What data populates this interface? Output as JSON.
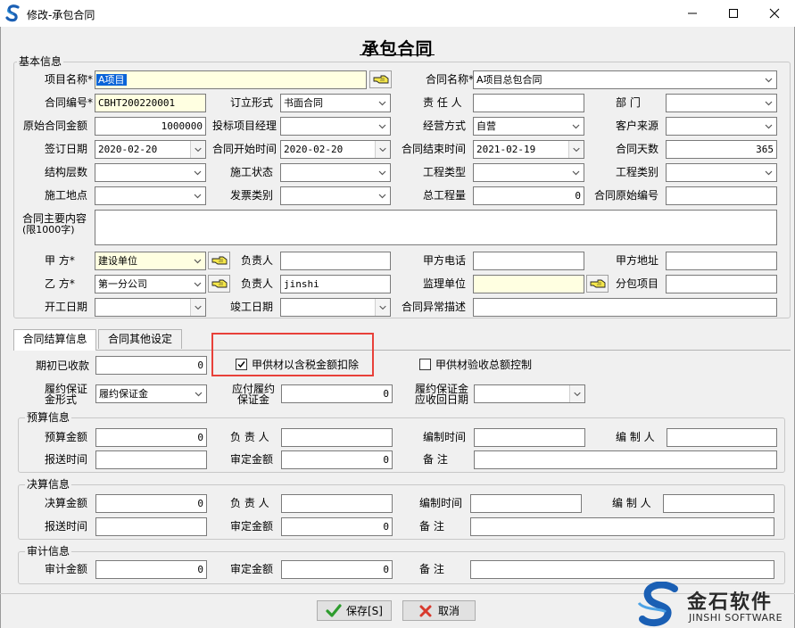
{
  "window": {
    "title": "修改-承包合同",
    "minimize": "—",
    "maximize": "□",
    "close": "✕"
  },
  "form": {
    "heading": "承包合同"
  },
  "basic": {
    "group": "基本信息",
    "project_name": {
      "label": "项目名称*",
      "value": "A项目"
    },
    "contract_name": {
      "label": "合同名称*",
      "value": "A项目总包合同"
    },
    "contract_no": {
      "label": "合同编号*",
      "value": "CBHT200220001"
    },
    "sign_form": {
      "label": "订立形式",
      "value": "书面合同"
    },
    "person_in_charge": {
      "label": "责 任 人",
      "value": ""
    },
    "department": {
      "label": "部    门",
      "value": ""
    },
    "original_amount": {
      "label": "原始合同金额",
      "value": "1000000"
    },
    "bid_manager": {
      "label": "投标项目经理",
      "value": ""
    },
    "business_mode": {
      "label": "经营方式",
      "value": "自营"
    },
    "customer_source": {
      "label": "客户来源",
      "value": ""
    },
    "sign_date": {
      "label": "签订日期",
      "value": "2020-02-20"
    },
    "start_time": {
      "label": "合同开始时间",
      "value": "2020-02-20"
    },
    "end_time": {
      "label": "合同结束时间",
      "value": "2021-02-19"
    },
    "days": {
      "label": "合同天数",
      "value": "365"
    },
    "structure_floors": {
      "label": "结构层数",
      "value": ""
    },
    "construction_state": {
      "label": "施工状态",
      "value": ""
    },
    "project_type": {
      "label": "工程类型",
      "value": ""
    },
    "project_category": {
      "label": "工程类别",
      "value": ""
    },
    "site": {
      "label": "施工地点",
      "value": ""
    },
    "invoice_type": {
      "label": "发票类别",
      "value": ""
    },
    "total_quantity": {
      "label": "总工程量",
      "value": "0"
    },
    "original_no": {
      "label": "合同原始编号",
      "value": ""
    },
    "content": {
      "label1": "合同主要内容",
      "label2": "(限1000字)",
      "value": ""
    },
    "party_a": {
      "label": "甲    方*",
      "value": "建设单位"
    },
    "a_contact": {
      "label": "负责人",
      "value": ""
    },
    "a_phone": {
      "label": "甲方电话",
      "value": ""
    },
    "a_address": {
      "label": "甲方地址",
      "value": ""
    },
    "party_b": {
      "label": "乙    方*",
      "value": "第一分公司"
    },
    "b_contact": {
      "label": "负责人",
      "value": "jinshi"
    },
    "supervisor": {
      "label": "监理单位",
      "value": ""
    },
    "subcontract": {
      "label": "分包项目",
      "value": ""
    },
    "work_start": {
      "label": "开工日期",
      "value": ""
    },
    "work_end": {
      "label": "竣工日期",
      "value": ""
    },
    "exception": {
      "label": "合同异常描述",
      "value": ""
    }
  },
  "tabs": [
    {
      "label": "合同结算信息"
    },
    {
      "label": "合同其他设定"
    }
  ],
  "settle": {
    "initial_received": {
      "label": "期初已收款",
      "value": "0"
    },
    "chk_deduct": {
      "label": "甲供材以含税金额扣除",
      "checked": true
    },
    "chk_total": {
      "label": "甲供材验收总额控制",
      "checked": false
    },
    "bond_form": {
      "label1": "履约保证",
      "label2": "金形式",
      "value": "履约保证金"
    },
    "bond_payable": {
      "label1": "应付履约",
      "label2": "保证金",
      "value": "0"
    },
    "bond_date": {
      "label1": "履约保证金",
      "label2": "应收回日期",
      "value": ""
    }
  },
  "budget": {
    "group": "预算信息",
    "amount": {
      "label": "预算金额",
      "value": "0"
    },
    "contact": {
      "label": "负 责 人",
      "value": ""
    },
    "made_time": {
      "label": "编制时间",
      "value": ""
    },
    "maker": {
      "label": "编 制 人",
      "value": ""
    },
    "send_time": {
      "label": "报送时间",
      "value": ""
    },
    "approved": {
      "label": "审定金额",
      "value": "0"
    },
    "note": {
      "label": "备    注",
      "value": ""
    }
  },
  "final": {
    "group": "决算信息",
    "amount": {
      "label": "决算金额",
      "value": "0"
    },
    "contact": {
      "label": "负 责 人",
      "value": ""
    },
    "made_time": {
      "label": "编制时间",
      "value": ""
    },
    "maker": {
      "label": "编 制 人",
      "value": ""
    },
    "send_time": {
      "label": "报送时间",
      "value": ""
    },
    "approved": {
      "label": "审定金额",
      "value": "0"
    },
    "note": {
      "label": "备    注",
      "value": ""
    }
  },
  "audit": {
    "group": "审计信息",
    "amount": {
      "label": "审计金额",
      "value": "0"
    },
    "approved": {
      "label": "审定金额",
      "value": "0"
    },
    "note": {
      "label": "备    注",
      "value": ""
    }
  },
  "buttons": {
    "save": "保存[S]",
    "cancel": "取消"
  },
  "brand": {
    "name": "金石软件",
    "sub": "JINSHI SOFTWARE"
  },
  "colors": {
    "highlight": "#e8413a",
    "required_bg": "#ffffe1",
    "selection": "#0a64d8"
  }
}
